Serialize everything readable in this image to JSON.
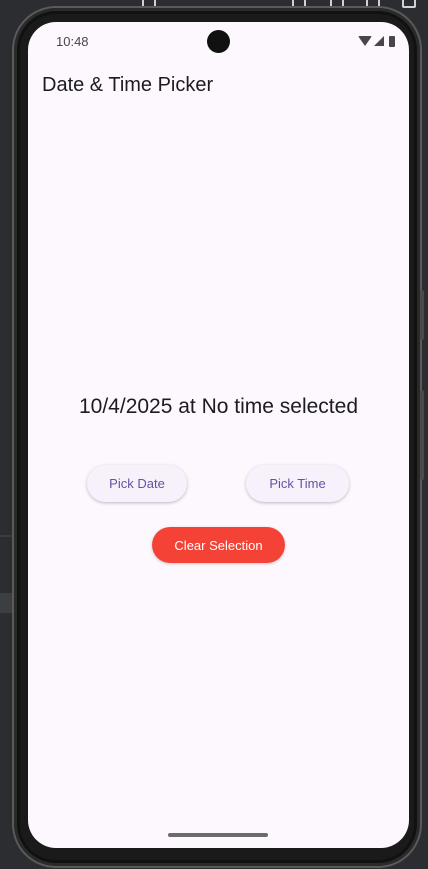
{
  "status_bar": {
    "time": "10:48",
    "icons": [
      "wifi-icon",
      "signal-icon",
      "battery-icon"
    ]
  },
  "app_bar": {
    "title": "Date & Time Picker"
  },
  "main": {
    "selection_text": "10/4/2025 at No time selected",
    "pick_date_label": "Pick Date",
    "pick_time_label": "Pick Time",
    "clear_label": "Clear Selection"
  },
  "colors": {
    "background": "#fdf7fe",
    "primary": "#6750a4",
    "clear_button": "#f44336",
    "text": "#1d1b20"
  }
}
